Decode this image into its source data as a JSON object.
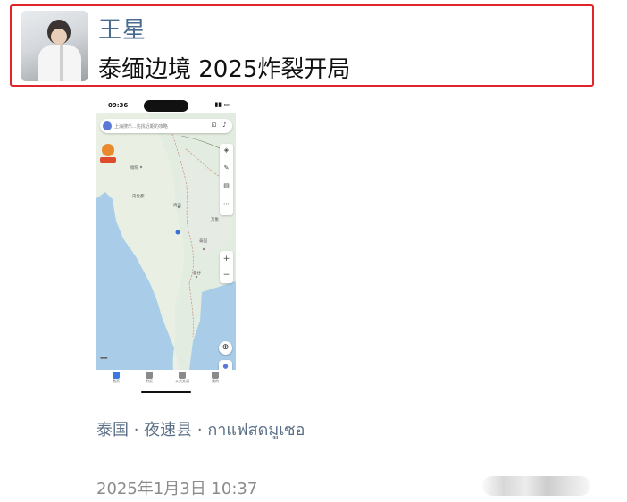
{
  "post": {
    "author_name": "王星",
    "text": "泰缅边境 2025炸裂开局",
    "location": "泰国 · 夜速县 · กาแฟสดมูเซอ",
    "timestamp": "2025年1月3日 10:37",
    "highlight_color": "#e0242a"
  },
  "screenshot": {
    "status": {
      "time": "09:36"
    },
    "search_placeholder": "上海搜乐...先找近期的攻略",
    "map_labels": [
      "缅甸",
      "内比都",
      "清迈",
      "泰国",
      "曼谷",
      "万象"
    ],
    "bottom_nav": [
      "首页",
      "附近",
      "公共交通",
      "我的"
    ],
    "icons": {
      "zoom_in": "+",
      "zoom_out": "−",
      "locate": "⊕"
    }
  }
}
